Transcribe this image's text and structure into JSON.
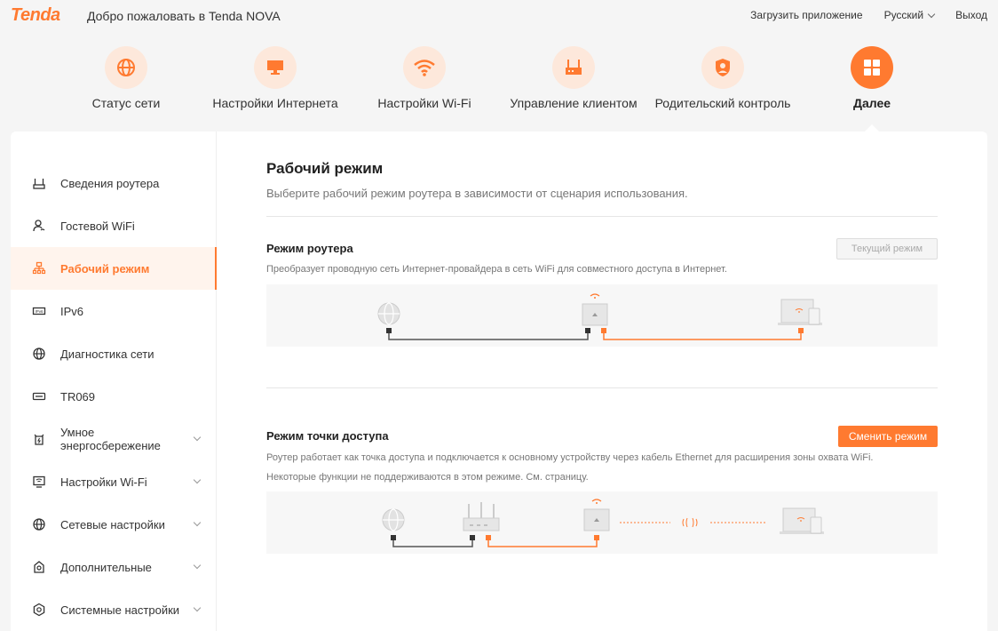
{
  "header": {
    "logo": "Tenda",
    "welcome": "Добро пожаловать в Tenda NOVA",
    "download_app": "Загрузить приложение",
    "language": "Русский",
    "logout": "Выход"
  },
  "nav": [
    {
      "label": "Статус сети",
      "icon": "globe-icon"
    },
    {
      "label": "Настройки Интернета",
      "icon": "monitor-icon"
    },
    {
      "label": "Настройки Wi-Fi",
      "icon": "wifi-icon"
    },
    {
      "label": "Управление клиентом",
      "icon": "router-icon"
    },
    {
      "label": "Родительский контроль",
      "icon": "parent-icon"
    },
    {
      "label": "Далее",
      "icon": "grid-icon",
      "active": true
    }
  ],
  "sidebar": {
    "items": [
      {
        "label": "Сведения роутера",
        "icon": "router-info-icon"
      },
      {
        "label": "Гостевой WiFi",
        "icon": "guest-icon"
      },
      {
        "label": "Рабочий режим",
        "icon": "network-mode-icon",
        "active": true
      },
      {
        "label": "IPv6",
        "icon": "ipv6-icon"
      },
      {
        "label": "Диагностика сети",
        "icon": "globe-icon"
      },
      {
        "label": "TR069",
        "icon": "tr069-icon"
      },
      {
        "label": "Умное энергосбережение",
        "icon": "energy-icon",
        "expandable": true
      },
      {
        "label": "Настройки Wi-Fi",
        "icon": "wifi-settings-icon",
        "expandable": true
      },
      {
        "label": "Сетевые настройки",
        "icon": "globe-icon",
        "expandable": true
      },
      {
        "label": "Дополнительные",
        "icon": "advanced-icon",
        "expandable": true
      },
      {
        "label": "Системные настройки",
        "icon": "system-icon",
        "expandable": true
      }
    ]
  },
  "main": {
    "title": "Рабочий режим",
    "subtitle": "Выберите рабочий режим роутера в зависимости от сценария использования.",
    "router_mode": {
      "title": "Режим роутера",
      "button": "Текущий режим",
      "description": "Преобразует проводную сеть Интернет-провайдера в сеть WiFi для совместного доступа в Интернет."
    },
    "ap_mode": {
      "title": "Режим точки доступа",
      "button": "Сменить режим",
      "description_1": "Роутер работает как точка доступа и подключается к основному устройству через кабель Ethernet для расширения зоны охвата WiFi.",
      "description_2": "Некоторые функции не поддерживаются в этом режиме. См. страницу."
    }
  },
  "colors": {
    "accent": "#ff7a30",
    "accent_light": "#fde8db",
    "background": "#f5f5f5"
  }
}
